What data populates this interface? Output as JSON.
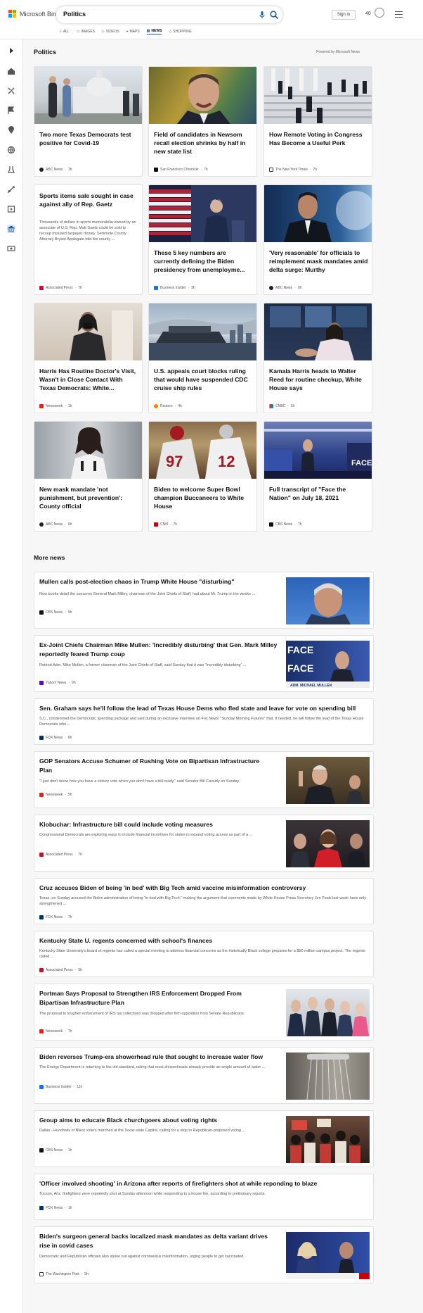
{
  "header": {
    "brand": "Microsoft Bing",
    "query": "Politics",
    "sign_in": "Sign in",
    "points": "40"
  },
  "tabs": [
    {
      "label": "ALL"
    },
    {
      "label": "IMAGES"
    },
    {
      "label": "VIDEOS"
    },
    {
      "label": "MAPS"
    },
    {
      "label": "NEWS"
    },
    {
      "label": "SHOPPING"
    }
  ],
  "section": {
    "title": "Politics",
    "powered": "Powered by Microsoft News"
  },
  "cards": [
    {
      "title": "Two more Texas Democrats test positive for Covid-19",
      "source": "ABC News",
      "age": "1h"
    },
    {
      "title": "Field of candidates in Newsom recall election shrinks by half in new state list",
      "source": "San Francisco Chronicle",
      "age": "7h"
    },
    {
      "title": "How Remote Voting in Congress Has Become a Useful Perk",
      "source": "The New York Times",
      "age": "7h"
    },
    {
      "title": "Sports items sale sought in case against ally of Rep. Gaetz",
      "snippet": "Thousands of dollars in sports memorabilia owned by an associate of U.S. Rep. Matt Gaetz could be sold to recoup misused taxpayer money. Seminole County Attorney Bryant Applegate told the county ...",
      "source": "Associated Press",
      "age": "7h"
    },
    {
      "title": "These 5 key numbers are currently defining the Biden presidency from unemployme...",
      "source": "Business Insider",
      "age": "5h"
    },
    {
      "title": "'Very reasonable' for officials to reimplement mask mandates amid delta surge: Murthy",
      "source": "ABC News",
      "age": "9h"
    },
    {
      "title": "Harris Has Routine Doctor's Visit, Wasn't in Close Contact With Texas Democrats: White...",
      "source": "Newsweek",
      "age": "1h"
    },
    {
      "title": "U.S. appeals court blocks ruling that would have suspended CDC cruise ship rules",
      "source": "Reuters",
      "age": "4h"
    },
    {
      "title": "Kamala Harris heads to Walter Reed for routine checkup, White House says",
      "source": "CNBC",
      "age": "5h"
    },
    {
      "title": "New mask mandate 'not punishment, but prevention': County official",
      "source": "ABC News",
      "age": "6h"
    },
    {
      "title": "Biden to welcome Super Bowl champion Buccaneers to White House",
      "source": "CNN",
      "age": "7h"
    },
    {
      "title": "Full transcript of \"Face the Nation\" on July 18, 2021",
      "source": "CBS News",
      "age": "7h"
    }
  ],
  "more": {
    "title": "More news",
    "items": [
      {
        "title": "Mullen calls post-election chaos in Trump White House \"disturbing\"",
        "snippet": "New books detail the concerns General Mark Milley, chairman of the Joint Chiefs of Staff, had about Mr. Trump in the weeks ...",
        "source": "CBS News",
        "age": "9h"
      },
      {
        "title": "Ex-Joint Chiefs Chairman Mike Mullen: 'Incredibly disturbing' that Gen. Mark Milley reportedly feared Trump coup",
        "snippet": "Retired Adm. Mike Mullen, a former chairman of the Joint Chiefs of Staff, said Sunday that it was \"incredibly disturbing\" ...",
        "source": "Yahoo! News",
        "age": "9h"
      },
      {
        "title": "Sen. Graham says he'll follow the lead of Texas House Dems who fled state and leave for vote on spending bill",
        "snippet": "S.C., condemned the Democratic spending package and said during an exclusive interview on Fox News' \"Sunday Morning Futures\" that, if needed, he will follow the lead of the Texas House Democrats who ...",
        "source": "FOX News",
        "age": "6h"
      },
      {
        "title": "GOP Senators Accuse Schumer of Rushing Vote on Bipartisan Infrastructure Plan",
        "snippet": "\"I just don't know how you have a cloture vote when you don't have a bill ready,\" said Senator Bill Cassidy on Sunday.",
        "source": "Newsweek",
        "age": "5h"
      },
      {
        "title": "Klobuchar: Infrastructure bill could include voting measures",
        "snippet": "Congressional Democrats are exploring ways to include financial incentives for states to expand voting access as part of a ...",
        "source": "Associated Press",
        "age": "7h"
      },
      {
        "title": "Cruz accuses Biden of being 'in bed' with Big Tech amid vaccine misinformation controversy",
        "snippet": "Texas, on Sunday accused the Biden administration of being \"in bed with Big Tech,\" making the argument that comments made by White House Press Secretary Jen Psaki last week have only strengthened ...",
        "source": "FOX News",
        "age": "7h"
      },
      {
        "title": "Kentucky State U. regents concerned with school's finances",
        "snippet": "Kentucky State University's board of regents has called a special meeting to address financial concerns as the historically Black college prepares for a $50 million campus project. The regents called ...",
        "source": "Associated Press",
        "age": "5h"
      },
      {
        "title": "Portman Says Proposal to Strengthen IRS Enforcement Dropped From Bipartisan Infrastructure Plan",
        "snippet": "The proposal to toughen enforcement of IRS tax collections was dropped after firm opposition from Senate Republicans.",
        "source": "Newsweek",
        "age": "7h"
      },
      {
        "title": "Biden reverses Trump-era showerhead rule that sought to increase water flow",
        "snippet": "The Energy Department is returning to the old standard, noting that most showerheads already provide an ample amount of water ...",
        "source": "Business Insider",
        "age": "11h"
      },
      {
        "title": "Group aims to educate Black churchgoers about voting rights",
        "snippet": "Dallas - Hundreds of Black voters marched at the Texas state Capitol, calling for a stop to Republican-proposed voting ...",
        "source": "CBS News",
        "age": "1h"
      },
      {
        "title": "'Officer involved shooting' in Arizona after reports of firefighters shot at while reponding to blaze",
        "snippet": "Tucson, Ariz. firefighters were reportedly shot at Sunday afternoon while responding to a house fire, according to preliminary reports.",
        "source": "FOX News",
        "age": "1h"
      },
      {
        "title": "Biden's surgeon general backs localized mask mandates as delta variant drives rise in covid cases",
        "snippet": "Democratic and Republican officials also spoke out against coronavirus misinformation, urging people to get vaccinated.",
        "source": "The Washington Post",
        "age": "5h"
      }
    ]
  },
  "image_text": {
    "face_screen": "FACE",
    "chyron": "ADM. MICHAEL MULLEN",
    "jersey_1": "97",
    "jersey_2": "12"
  }
}
